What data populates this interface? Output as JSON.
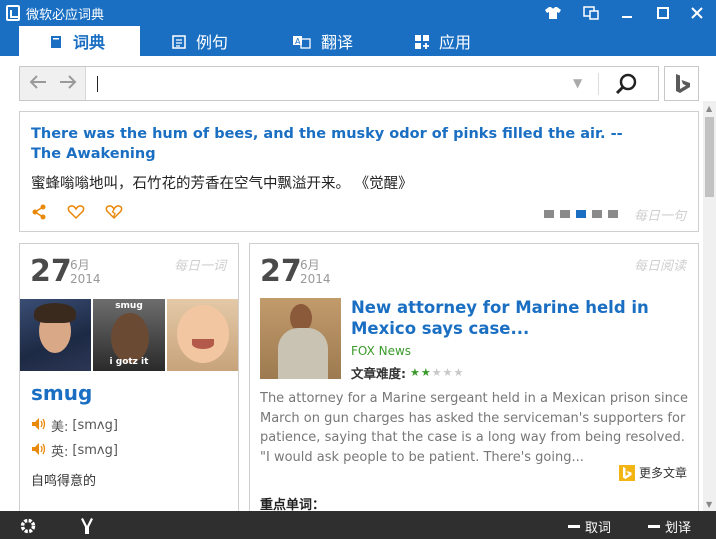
{
  "window": {
    "title": "微软必应词典",
    "colors": {
      "brand": "#1a6fc3",
      "accent": "#e8890c",
      "source_green": "#3a9a2a"
    }
  },
  "tabs": [
    {
      "label": "词典",
      "icon": "book-icon",
      "active": true
    },
    {
      "label": "例句",
      "icon": "document-icon",
      "active": false
    },
    {
      "label": "翻译",
      "icon": "translate-icon",
      "active": false
    },
    {
      "label": "应用",
      "icon": "apps-icon",
      "active": false
    }
  ],
  "search": {
    "value": "",
    "placeholder": ""
  },
  "daily_sentence": {
    "english": "There was the hum of bees, and the musky odor of pinks filled the air. -- The Awakening",
    "chinese": "蜜蜂嗡嗡地叫，石竹花的芳香在空气中飘溢开来。 《觉醒》",
    "label": "每日一句",
    "pages": 5,
    "active_page": 4
  },
  "word_card": {
    "day": "27",
    "month": "6月",
    "year": "2014",
    "label": "每日一词",
    "image_captions": [
      "smug",
      "i gotz it"
    ],
    "word": "smug",
    "us_label": "美:",
    "us_phonetic": "[smʌg]",
    "uk_label": "英:",
    "uk_phonetic": "[smʌg]",
    "meaning": "自鸣得意的"
  },
  "reading_card": {
    "day": "27",
    "month": "6月",
    "year": "2014",
    "label": "每日阅读",
    "title": "New attorney for Marine held in Mexico says case...",
    "source": "FOX News",
    "difficulty_label": "文章难度:",
    "difficulty": 2,
    "difficulty_max": 5,
    "body": "The attorney for a Marine sergeant held in a Mexican prison since March on gun charges has asked the serviceman's supporters for patience, saying that the case is a long way from being resolved. \"I would ask people to be patient. There's going...",
    "more_label": "更多文章",
    "keywords_label": "重点单词："
  },
  "bottom_bar": {
    "pick_word": "取词",
    "pick_translate": "划译"
  }
}
